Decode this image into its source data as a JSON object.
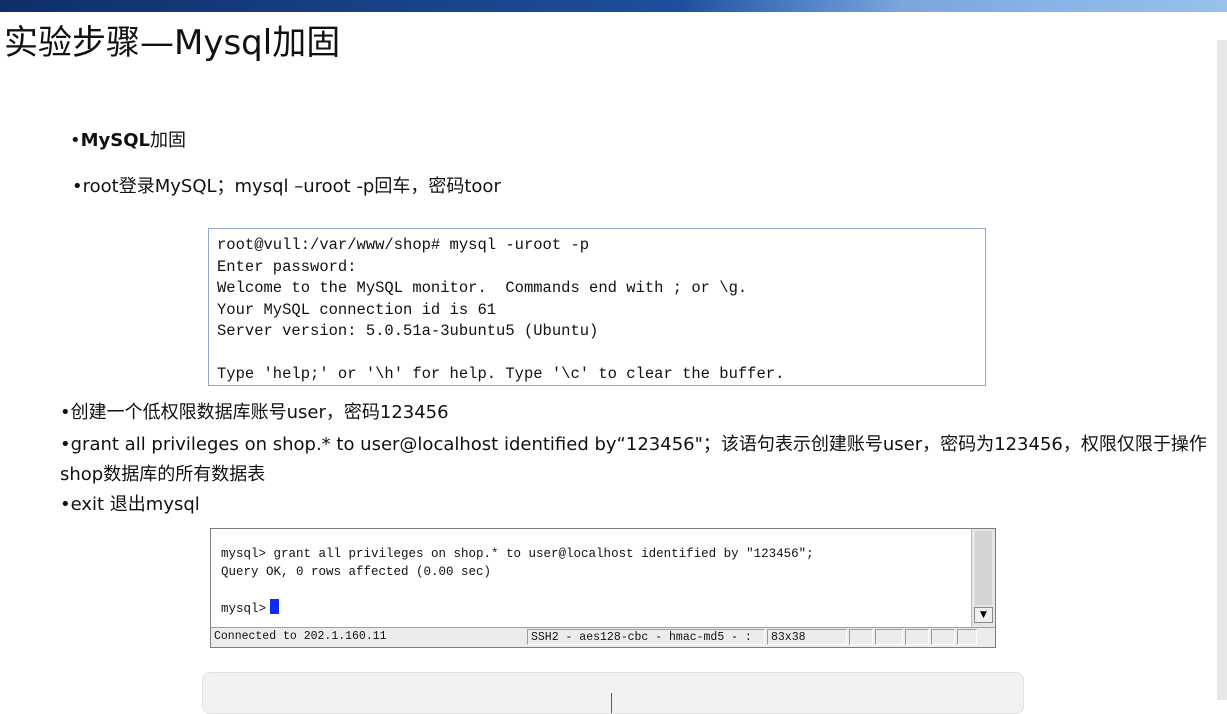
{
  "slide": {
    "title": "实验步骤—Mysql加固"
  },
  "bullets": {
    "b1_prefix": "•",
    "b1_bold": "MySQL",
    "b1_rest": "加固",
    "b2": "•root登录MySQL；mysql –uroot -p回车，密码toor",
    "b3": "•创建一个低权限数据库账号user，密码123456",
    "b4": "•grant all privileges on shop.* to user@localhost identified by“123456\"；该语句表示创建账号user，密码为123456，权限仅限于操作shop数据库的所有数据表",
    "b5": "•exit  退出mysql"
  },
  "terminal1": {
    "lines": [
      "root@vull:/var/www/shop# mysql -uroot -p",
      "Enter password:",
      "Welcome to the MySQL monitor.  Commands end with ; or \\g.",
      "Your MySQL connection id is 61",
      "Server version: 5.0.51a-3ubuntu5 (Ubuntu)",
      "",
      "Type 'help;' or '\\h' for help. Type '\\c' to clear the buffer."
    ]
  },
  "terminal2": {
    "line1": "mysql> grant all privileges on shop.* to user@localhost identified by \"123456\";",
    "line2": "Query OK, 0 rows affected (0.00 sec)",
    "prompt": "mysql>",
    "status_connection": "Connected to 202.1.160.11",
    "status_cipher": "SSH2 - aes128-cbc - hmac-md5 - :",
    "status_size": "83x38",
    "scroll_arrow": "▼"
  },
  "colors": {
    "header_bar": "#1e4f9c",
    "cursor": "#0a2bff"
  }
}
